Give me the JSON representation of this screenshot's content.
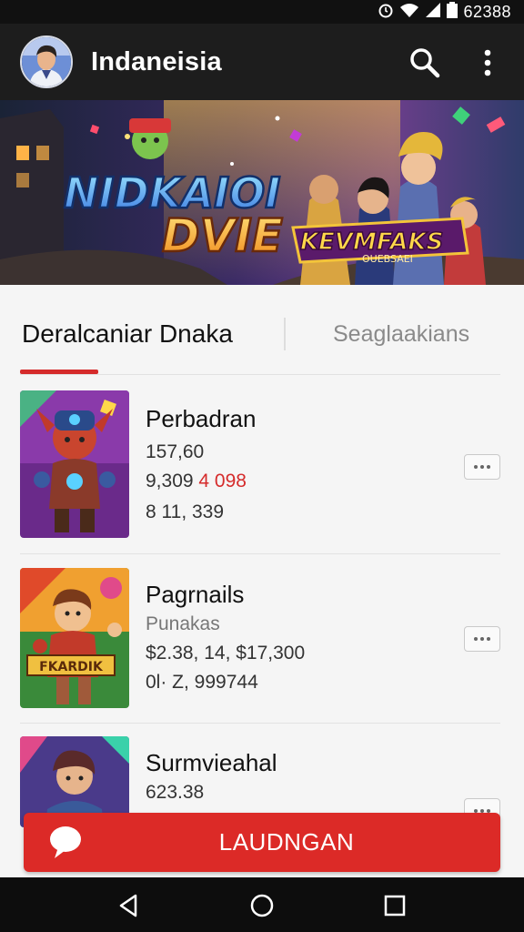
{
  "status_bar": {
    "clock": "62388"
  },
  "app_bar": {
    "title": "Indaneisia"
  },
  "banner": {
    "headline_line1": "NIDKAIOI",
    "headline_line2": "DVIE",
    "badge_title": "KEVMFAKS",
    "badge_sub": "OUEBSAEI"
  },
  "tabs": [
    {
      "label": "Deralcaniar Dnaka",
      "selected": true
    },
    {
      "label": "Seaglaakians",
      "selected": false
    }
  ],
  "items": [
    {
      "title": "Perbadran",
      "line1": "157,60",
      "line2_prefix": "9,309",
      "line2_red": "4 098",
      "line3": "8 11, 339"
    },
    {
      "title": "Pagrnails",
      "line1": "Punakas",
      "line2": "$2.38, 14, $17,300",
      "line3": "0l· Z, 999744"
    },
    {
      "title": "Surmvieahal",
      "line1": "623.38"
    }
  ],
  "cta": {
    "label": "LAUDNGAN"
  },
  "icons": {
    "search": "search-icon",
    "more": "more-vertical-icon",
    "chat": "chat-bubble-icon",
    "back": "back-triangle-icon",
    "home": "home-circle-icon",
    "recents": "recents-square-icon"
  },
  "colors": {
    "accent": "#dc2a27",
    "appbar": "#1d1d1d",
    "background": "#f5f5f5"
  }
}
